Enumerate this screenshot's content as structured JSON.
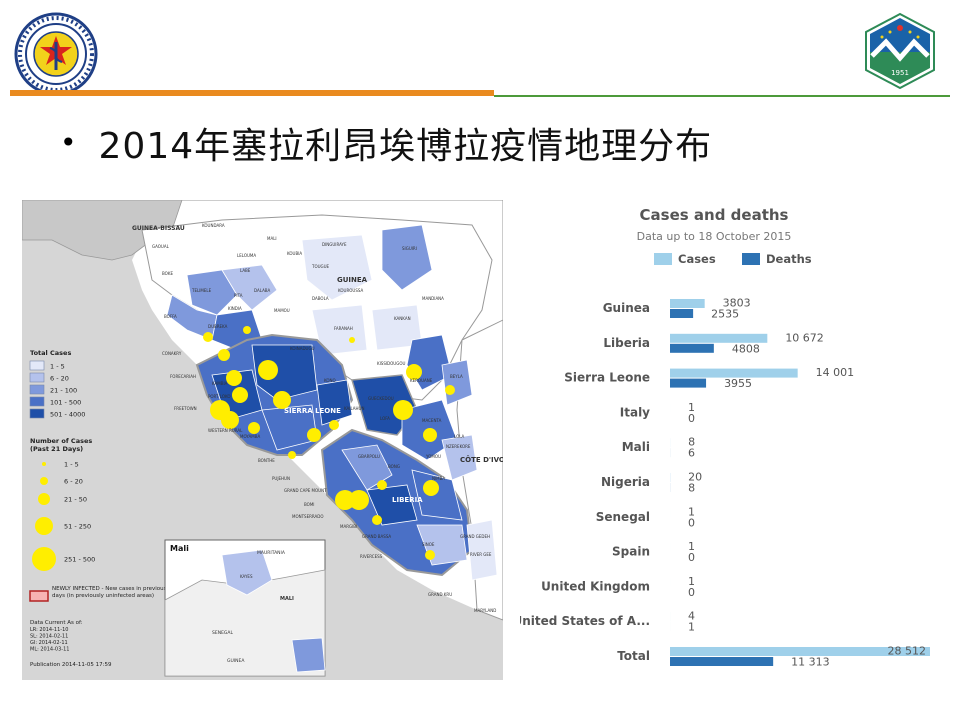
{
  "header": {
    "left_logo": {
      "icon": "health-bureau-seal-icon",
      "ring_color": "#1f3f86",
      "center_color": "#f2d21b"
    },
    "right_logo": {
      "icon": "university-shield-icon",
      "year": "1951",
      "colors": [
        "#ffffff",
        "#2e8b57",
        "#1a62a8",
        "#e0312b"
      ]
    },
    "accent_orange": "#e98a1f",
    "accent_green": "#4c9a3a"
  },
  "title": "2014年塞拉利昂埃博拉疫情地理分布",
  "map": {
    "countries": [
      "GUINEA-BISSAU",
      "GUINEA",
      "SIERRA LEONE",
      "LIBERIA",
      "CÔTE D'IVOIRE"
    ],
    "prefecture_labels": [
      "GAOUAL",
      "KOUNDARA",
      "MALI",
      "LELOUMA",
      "LABE",
      "KOUBIA",
      "TOUGUE",
      "DINGUIRAYE",
      "SIGUIRI",
      "BOKE",
      "TELIMELE",
      "PITA",
      "DALABA",
      "MAMOU",
      "DABOLA",
      "KOUROUSSA",
      "MANDIANA",
      "BOFFA",
      "KINDIA",
      "FARANAH",
      "KANKAN",
      "DUBREKA",
      "CONAKRY",
      "FORECARIAH",
      "KAMBIA",
      "KISSIDOUGOU",
      "KEROUANE",
      "BEYLA",
      "PORT LOKO",
      "FREETOWN",
      "WESTERN RURAL",
      "MOYAMBA",
      "BONTHE",
      "PUJEHUN",
      "KOINADUGU",
      "KONO",
      "KAILAHUN",
      "GUECKEDOU",
      "MACENTA",
      "YOMOU",
      "LOLA",
      "NZEREKORE",
      "GRAND CAPE MOUNT",
      "BOMI",
      "MONTSERRADO",
      "MARGIBI",
      "GRAND BASSA",
      "RIVERCESS",
      "SINOE",
      "GRAND GEDEH",
      "RIVER GEE",
      "GRAND KRU",
      "MARYLAND",
      "NIMBA",
      "BONG",
      "GBARPOLU",
      "LOFA"
    ],
    "legend": {
      "total_title": "Total Cases",
      "total_ranges": [
        "1 - 5",
        "6 - 20",
        "21 - 100",
        "101 - 500",
        "501 - 4000"
      ],
      "total_colors": [
        "#e3e8f8",
        "#b4c2ec",
        "#7f99dc",
        "#4a70c6",
        "#1f4fa8"
      ],
      "recent_title": "Number of Cases\n(Past 21 Days)",
      "recent_ranges": [
        "1 - 5",
        "6 - 20",
        "21 - 50",
        "51 - 250",
        "251 - 500"
      ],
      "bubble_color": "#ffee00",
      "newly_infected": "NEWLY INFECTED - New cases in previous 7 days (in previously uninfected areas)",
      "data_current_title": "Data Current As of:",
      "data_current": [
        "LR: 2014-11-10",
        "SL: 2014-02-11",
        "GI: 2014-02-11",
        "ML: 2014-03-11"
      ],
      "publication": "Publication 2014-11-05  17:59"
    },
    "inset": {
      "title": "Mali",
      "labels": [
        "MAURITANIA",
        "GUINEA",
        "SENEGAL",
        "MALI",
        "KAYES"
      ]
    },
    "border_color": "#9a9a9a",
    "land_color": "#ffffff",
    "sea_color": "#d6d6d6"
  },
  "chart_data": {
    "type": "bar",
    "title": "Cases and deaths",
    "subtitle": "Data up to 18 October 2015",
    "orientation": "horizontal",
    "categories": [
      "Guinea",
      "Liberia",
      "Sierra Leone",
      "Italy",
      "Mali",
      "Nigeria",
      "Senegal",
      "Spain",
      "United Kingdom",
      "United States of A...",
      "Total"
    ],
    "series": [
      {
        "name": "Cases",
        "color": "#9fd0ea",
        "values": [
          3803,
          10672,
          14001,
          1,
          8,
          20,
          1,
          1,
          1,
          4,
          28512
        ]
      },
      {
        "name": "Deaths",
        "color": "#2d72b3",
        "values": [
          2535,
          4808,
          3955,
          0,
          6,
          8,
          0,
          0,
          0,
          1,
          11313
        ]
      }
    ],
    "value_labels": {
      "Cases": [
        "3803",
        "10 672",
        "14 001",
        "1",
        "8",
        "20",
        "1",
        "1",
        "1",
        "4",
        "28 512"
      ],
      "Deaths": [
        "2535",
        "4808",
        "3955",
        "0",
        "6",
        "8",
        "0",
        "0",
        "0",
        "1",
        "11 313"
      ]
    },
    "xlim": [
      0,
      28512
    ],
    "grid": false,
    "legend": "top"
  }
}
